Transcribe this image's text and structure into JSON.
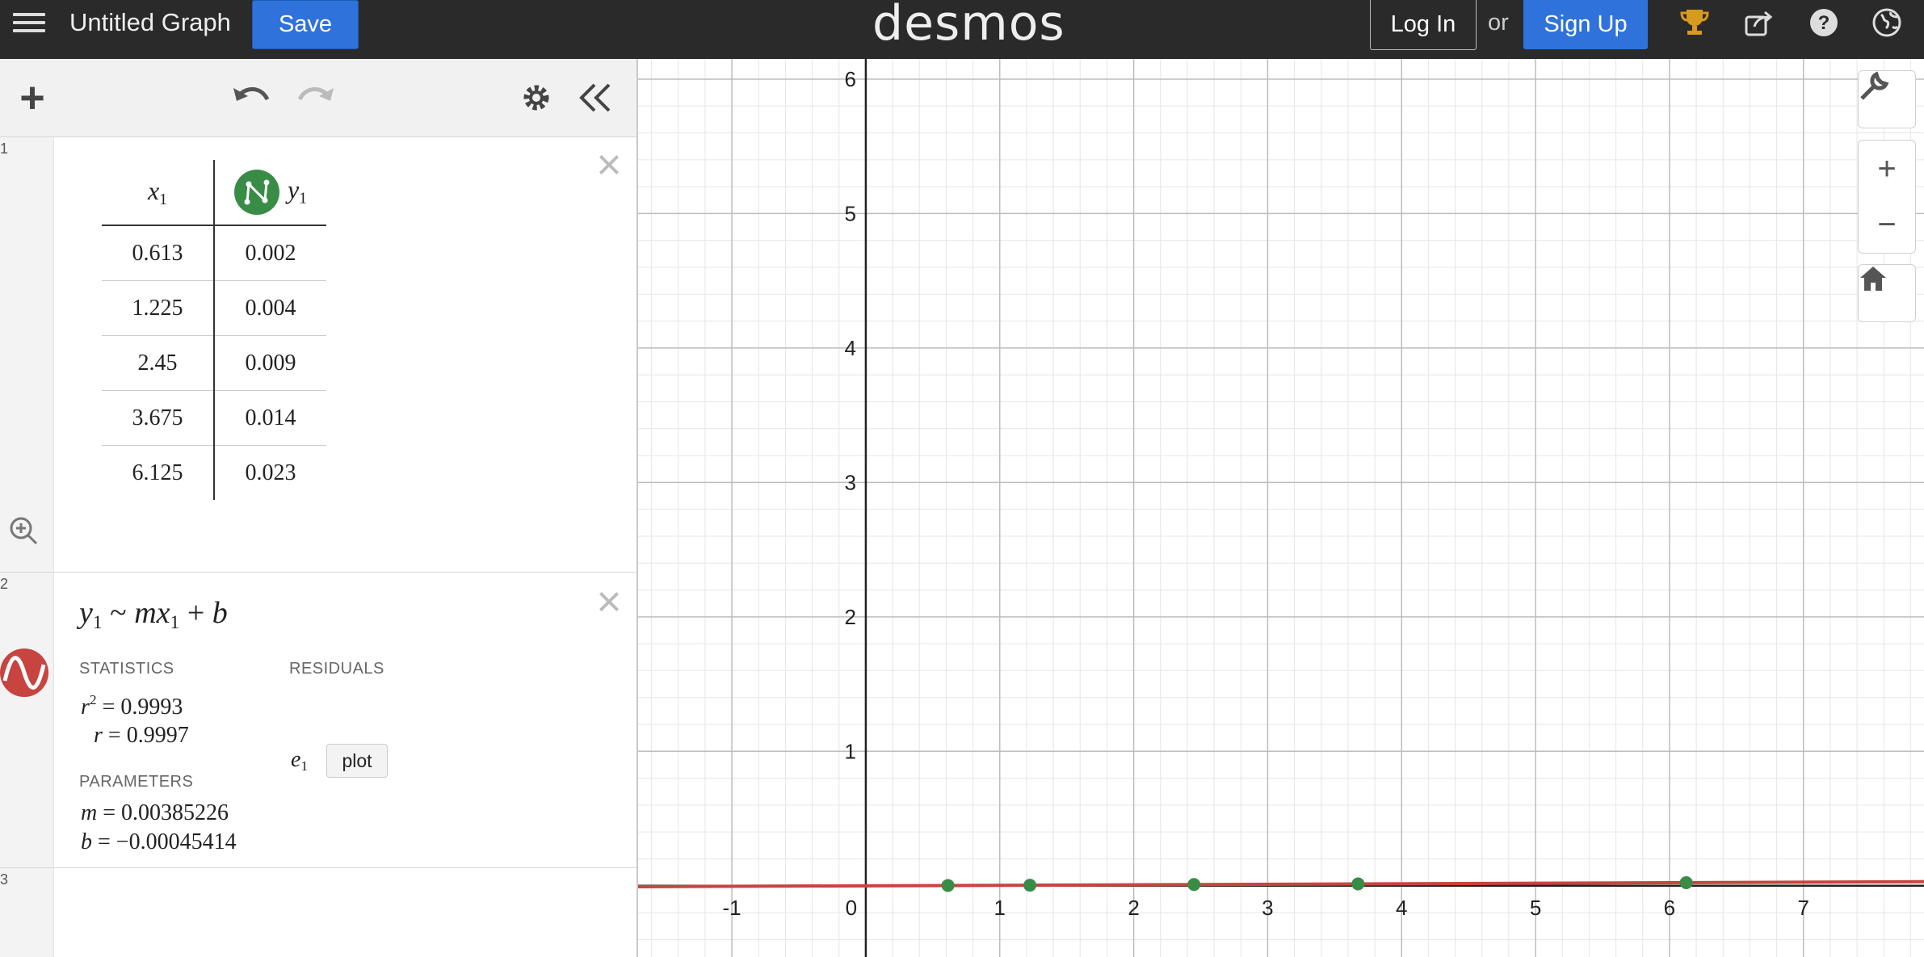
{
  "topbar": {
    "title": "Untitled Graph",
    "save_label": "Save",
    "logo": "desmos",
    "login_label": "Log In",
    "or_text": "or",
    "signup_label": "Sign Up",
    "icons": [
      "trophy-icon",
      "share-icon",
      "help-icon",
      "globe-icon"
    ]
  },
  "toolbar": {
    "icons": [
      "add-icon",
      "undo-icon",
      "redo-icon",
      "settings-icon",
      "collapse-icon"
    ]
  },
  "expressions": [
    {
      "index": "1",
      "type": "table",
      "columns": [
        {
          "var": "x",
          "sub": "1"
        },
        {
          "var": "y",
          "sub": "1"
        }
      ],
      "rows": [
        [
          "0.613",
          "0.002"
        ],
        [
          "1.225",
          "0.004"
        ],
        [
          "2.45",
          "0.009"
        ],
        [
          "3.675",
          "0.014"
        ],
        [
          "6.125",
          "0.023"
        ]
      ]
    },
    {
      "index": "2",
      "type": "regression",
      "formula": {
        "lhs": "y",
        "lhs_sub": "1",
        "op": "~",
        "m": "m",
        "x": "x",
        "x_sub": "1",
        "plus": "+",
        "b": "b"
      },
      "statistics_label": "STATISTICS",
      "residuals_label": "RESIDUALS",
      "r2": {
        "name": "r",
        "exp": "2",
        "eq": "= 0.9993"
      },
      "r": {
        "name": "r",
        "eq": "= 0.9997"
      },
      "residual_var": {
        "name": "e",
        "sub": "1"
      },
      "plot_label": "plot",
      "parameters_label": "PARAMETERS",
      "m": {
        "name": "m",
        "eq": "= 0.00385226"
      },
      "b": {
        "name": "b",
        "eq": "= −0.00045414"
      }
    },
    {
      "index": "3",
      "type": "empty"
    }
  ],
  "graph": {
    "x_ticks": [
      "-1",
      "0",
      "1",
      "2",
      "3",
      "4",
      "5",
      "6",
      "7"
    ],
    "y_ticks": [
      "1",
      "2",
      "3",
      "4",
      "5",
      "6"
    ],
    "points_color": "#388c46",
    "line_color": "#c74440",
    "side_controls": [
      "wrench-icon",
      "zoom-in-icon",
      "zoom-out-icon",
      "home-icon"
    ]
  },
  "chart_data": {
    "type": "scatter",
    "series": [
      {
        "x": [
          0.613,
          1.225,
          2.45,
          3.675,
          6.125
        ],
        "y": [
          0.002,
          0.004,
          0.009,
          0.014,
          0.023
        ]
      }
    ],
    "regression": {
      "m": 0.00385226,
      "b": -0.00045414
    },
    "xlim": [
      -1.7,
      7.9
    ],
    "ylim": [
      -0.53,
      6.15
    ],
    "grid": true
  }
}
